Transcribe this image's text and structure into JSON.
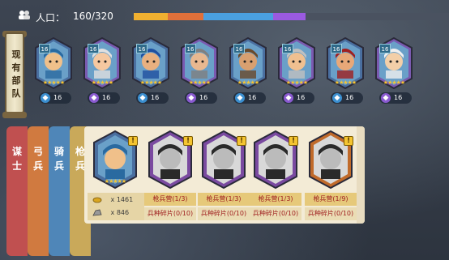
{
  "topbar": {
    "population_label": "人口：",
    "population_value": "160/320",
    "bar_colors": [
      "#f0b030",
      "#e0703a",
      "#4aa0e0",
      "#9a5ae0"
    ]
  },
  "banner": {
    "text": "现有部队"
  },
  "heroes": [
    {
      "level": "16",
      "foot_value": "16",
      "foot_icon": "star-badge-icon",
      "badge_color": "#3b8fd0",
      "frame": "#4a6fa0"
    },
    {
      "level": "16",
      "foot_value": "16",
      "foot_icon": "lightning-icon",
      "badge_color": "#8a5ad0",
      "frame": "#7a5ab0"
    },
    {
      "level": "16",
      "foot_value": "16",
      "foot_icon": "arrow-up-icon",
      "badge_color": "#3b8fd0",
      "frame": "#4a6fa0"
    },
    {
      "level": "16",
      "foot_value": "16",
      "foot_icon": "lightning-icon",
      "badge_color": "#8a5ad0",
      "frame": "#7a5ab0"
    },
    {
      "level": "16",
      "foot_value": "16",
      "foot_icon": "cycle-icon",
      "badge_color": "#3b8fd0",
      "frame": "#4a6fa0"
    },
    {
      "level": "16",
      "foot_value": "16",
      "foot_icon": "heart-icon",
      "badge_color": "#8a5ad0",
      "frame": "#7a5ab0"
    },
    {
      "level": "16",
      "foot_value": "16",
      "foot_icon": "shield-icon",
      "badge_color": "#3b8fd0",
      "frame": "#4a6fa0"
    },
    {
      "level": "16",
      "foot_value": "16",
      "foot_icon": "shield-icon",
      "badge_color": "#8a5ad0",
      "frame": "#7a5ab0"
    }
  ],
  "tabs": [
    {
      "label": "谋士",
      "color": "#c05050"
    },
    {
      "label": "弓兵",
      "color": "#d07a40"
    },
    {
      "label": "骑兵",
      "color": "#4f86b8"
    },
    {
      "label": "枪兵",
      "color": "#c9a95a"
    }
  ],
  "stock": {
    "coin_value": "x 1461",
    "ore_value": "x 846"
  },
  "recruit_cards": [
    {
      "alert": "!",
      "need1": "",
      "need2": ""
    },
    {
      "alert": "!",
      "need1": "枪兵营(1/3)",
      "need2": "兵种碎片(0/10)"
    },
    {
      "alert": "!",
      "need1": "枪兵营(1/3)",
      "need2": "兵种碎片(0/10)"
    },
    {
      "alert": "!",
      "need1": "枪兵营(1/3)",
      "need2": "兵种碎片(0/10)"
    },
    {
      "alert": "!",
      "need1": "枪兵营(1/9)",
      "need2": "兵种碎片(0/10)"
    }
  ]
}
